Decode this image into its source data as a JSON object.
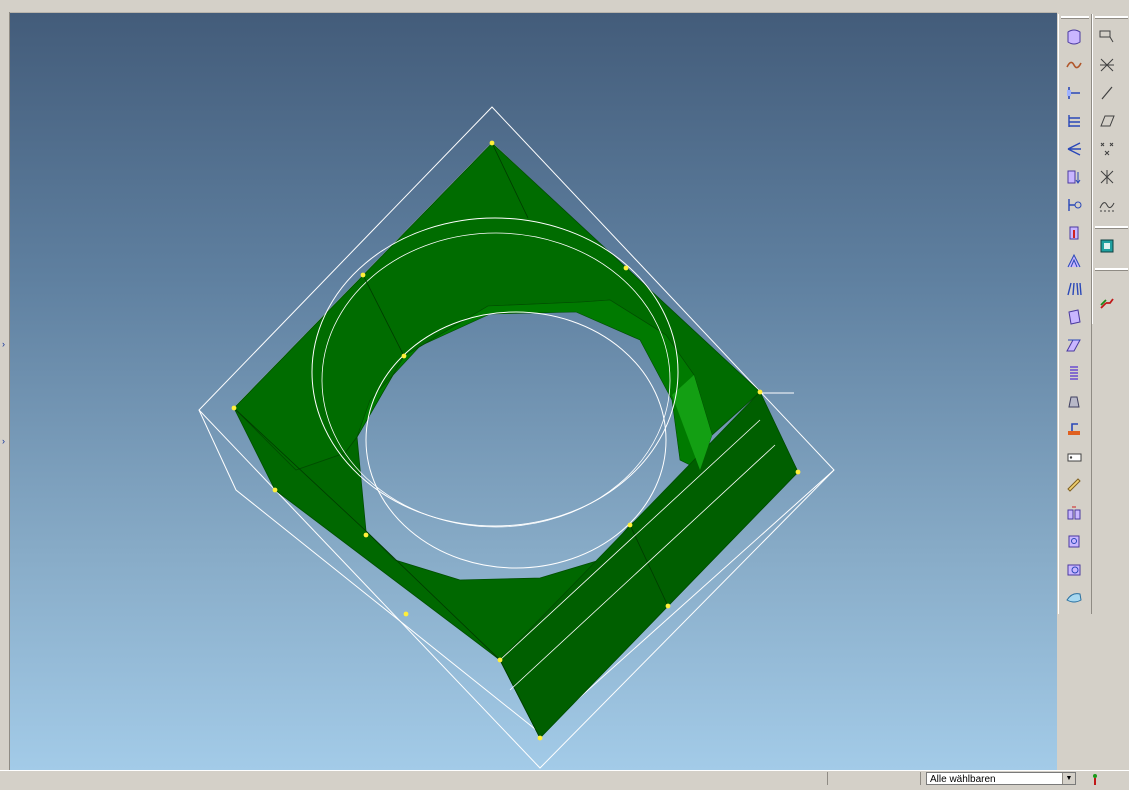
{
  "statusbar": {
    "selection_filter": "Alle wählbaren"
  },
  "toolbar_left": {
    "tools": [
      "surface-modeler-icon",
      "spline-curve-icon",
      "datum-plane-icon",
      "offset-planes-icon",
      "datum-axis-icon",
      "extrude-icon",
      "revolve-icon",
      "thicken-icon",
      "sweep-icon",
      "pattern-icon",
      "wrap-icon",
      "blend-icon",
      "helix-icon",
      "draft-icon",
      "round-icon",
      "tag-icon",
      "measure-icon",
      "analysis-icon",
      "mass-properties-icon",
      "cross-section-icon",
      "surface-analysis-icon"
    ]
  },
  "toolbar_right": {
    "tools": [
      "sketch-icon",
      "trim-icon",
      "line-icon",
      "plane-icon",
      "point-icon",
      "coord-system-icon",
      "curve-icon",
      "model-tree-icon",
      "relations-icon"
    ]
  },
  "colors": {
    "part_fill": "#006c00",
    "part_highlight": "#139f13",
    "wire": "#ffffff",
    "vertex": "#ffef3a"
  }
}
